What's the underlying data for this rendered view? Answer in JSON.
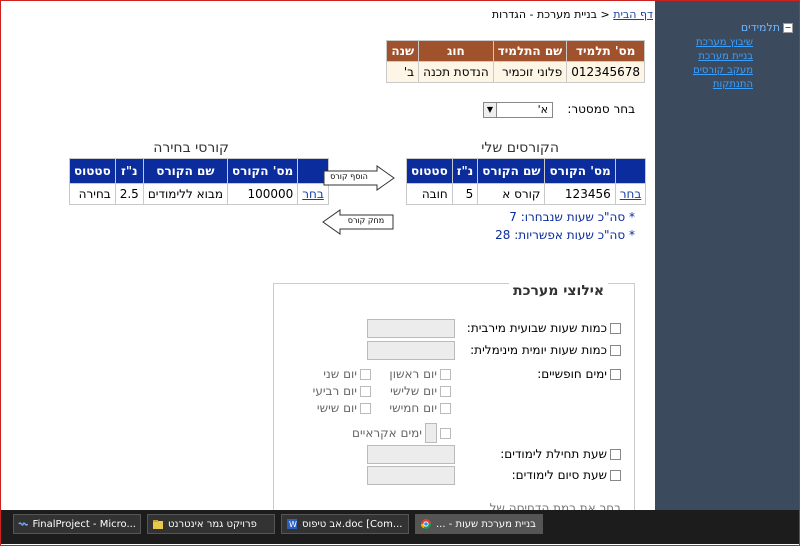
{
  "breadcrumb": {
    "home": "דף הבית",
    "separator": "<",
    "current": "בניית מערכת - הגדרות"
  },
  "sidebar": {
    "header": "תלמידים",
    "items": [
      "שיבוץ מערכת",
      "בניית מערכת",
      "מעקב קורסים",
      "התנתקות"
    ]
  },
  "student_table": {
    "headers": [
      "מס' תלמיד",
      "שם התלמיד",
      "חוג",
      "שנה"
    ],
    "row": [
      "012345678",
      "פלוני זוכמיר",
      "הנדסת תכנה",
      "ב'"
    ]
  },
  "semester": {
    "label": "בחר סמסטר:",
    "value": "א'"
  },
  "my_courses": {
    "title": "הקורסים שלי",
    "headers": [
      "מס' הקורס",
      "שם הקורס",
      "נ\"ז",
      "סטטוס"
    ],
    "row": {
      "action": "בחר",
      "number": "123456",
      "name": "קורס א",
      "credits": "5",
      "status": "חובה"
    }
  },
  "elective_courses": {
    "title": "קורסי בחירה",
    "headers": [
      "מס' הקורס",
      "שם הקורס",
      "נ\"ז",
      "סטטוס"
    ],
    "row": {
      "action": "בחר",
      "number": "100000",
      "name": "מבוא ללימודים",
      "credits": "2.5",
      "status": "בחירה"
    }
  },
  "buttons": {
    "add": "הוסף קורס",
    "remove": "מחק קורס"
  },
  "stats": {
    "chosen": "* סה\"כ שעות שנבחרו: 7",
    "possible": "* סה\"כ שעות אפשריות: 28"
  },
  "filters": {
    "legend": "אילוצי מערכת",
    "max_weekly": "כמות שעות שבועית מירבית:",
    "min_daily": "כמות שעות יומית מינימלית:",
    "free_days": "ימים חופשיים:",
    "days": [
      "יום ראשון",
      "יום שני",
      "יום שלישי",
      "יום רביעי",
      "יום חמישי",
      "יום שישי"
    ],
    "random_days": "ימים אקראיים",
    "start_time": "שעת תחילת לימודים:",
    "end_time": "שעת סיום לימודים:",
    "compress": "בחר את רמת הדחיסה של"
  },
  "taskbar": {
    "items": [
      "FinalProject - Micro...",
      "פרויקט גמר אינטרנט",
      "אב טיפוס.doc [Com...",
      "בניית מערכת שעות - ..."
    ]
  }
}
